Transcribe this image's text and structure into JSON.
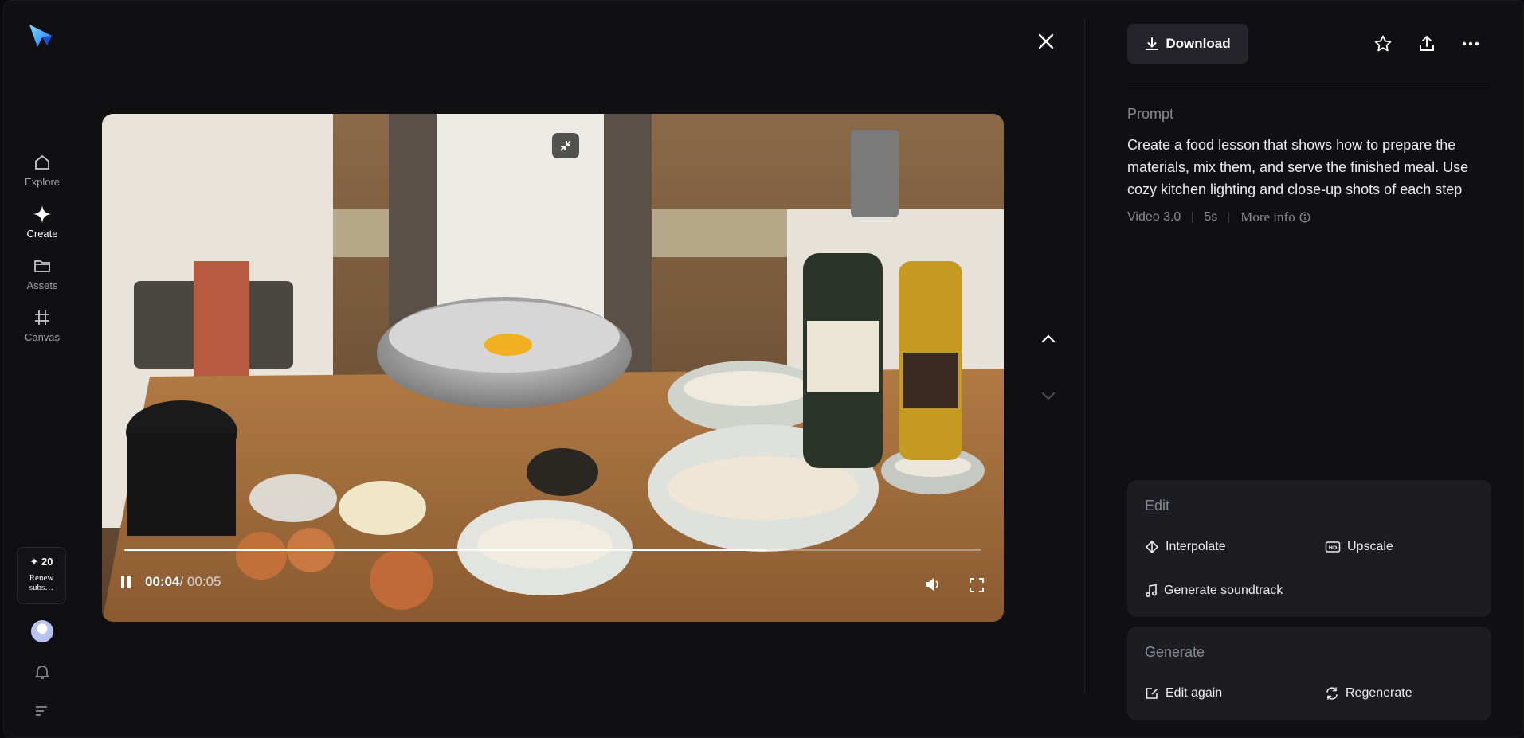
{
  "sidebar": {
    "items": [
      {
        "label": "Explore",
        "icon": "home-icon"
      },
      {
        "label": "Create",
        "icon": "sparkle-icon",
        "active": true
      },
      {
        "label": "Assets",
        "icon": "folder-icon"
      },
      {
        "label": "Canvas",
        "icon": "canvas-icon"
      }
    ],
    "credits": {
      "count": "✦ 20",
      "renew": "Renew subs…"
    }
  },
  "video": {
    "current_time": "00:04",
    "duration": "/ 00:05",
    "progress_fraction": 0.75
  },
  "panel": {
    "download_label": "Download",
    "prompt_heading": "Prompt",
    "prompt_text": "Create a food lesson that shows how to prepare the materials, mix them, and serve the finished meal. Use cozy kitchen lighting and close-up shots of each step",
    "meta": {
      "model": "Video 3.0",
      "length": "5s",
      "more_info": "More info"
    },
    "edit": {
      "heading": "Edit",
      "options": [
        "Interpolate",
        "Upscale",
        "Generate soundtrack"
      ]
    },
    "generate": {
      "heading": "Generate",
      "options": [
        "Edit again",
        "Regenerate"
      ]
    }
  },
  "colors": {
    "background": "#101013",
    "card": "#1c1c21",
    "accent": "#2aa8ff"
  }
}
